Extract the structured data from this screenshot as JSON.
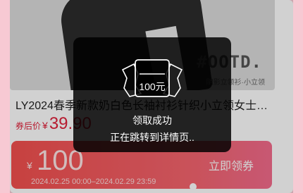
{
  "product": {
    "image_overlay_text": "#OOTD.",
    "image_caption": "阴影立领衫·小立领",
    "title": "LY2024春季新款奶白色长袖衬衫针织小立领女士打底…",
    "price_label": "券后价",
    "price_currency": "¥",
    "price_value": "39.90"
  },
  "coupon": {
    "currency": "¥",
    "amount": "100",
    "valid_dates": "2024.02.25 00:00–2024.02.29 23:59",
    "claim_button": "立即领券"
  },
  "toast": {
    "ticket_amount": "100元",
    "message_primary": "领取成功",
    "message_secondary": "正在跳转到详情页.."
  },
  "colors": {
    "background": "#f7c9d3",
    "accent_red": "#e0203a",
    "coupon_gradient_start": "#f3504e",
    "coupon_gradient_end": "#f46c8d",
    "toast_bg": "rgba(0,0,0,0.84)"
  },
  "icons": {
    "toast_icon": "ticket-icon"
  }
}
